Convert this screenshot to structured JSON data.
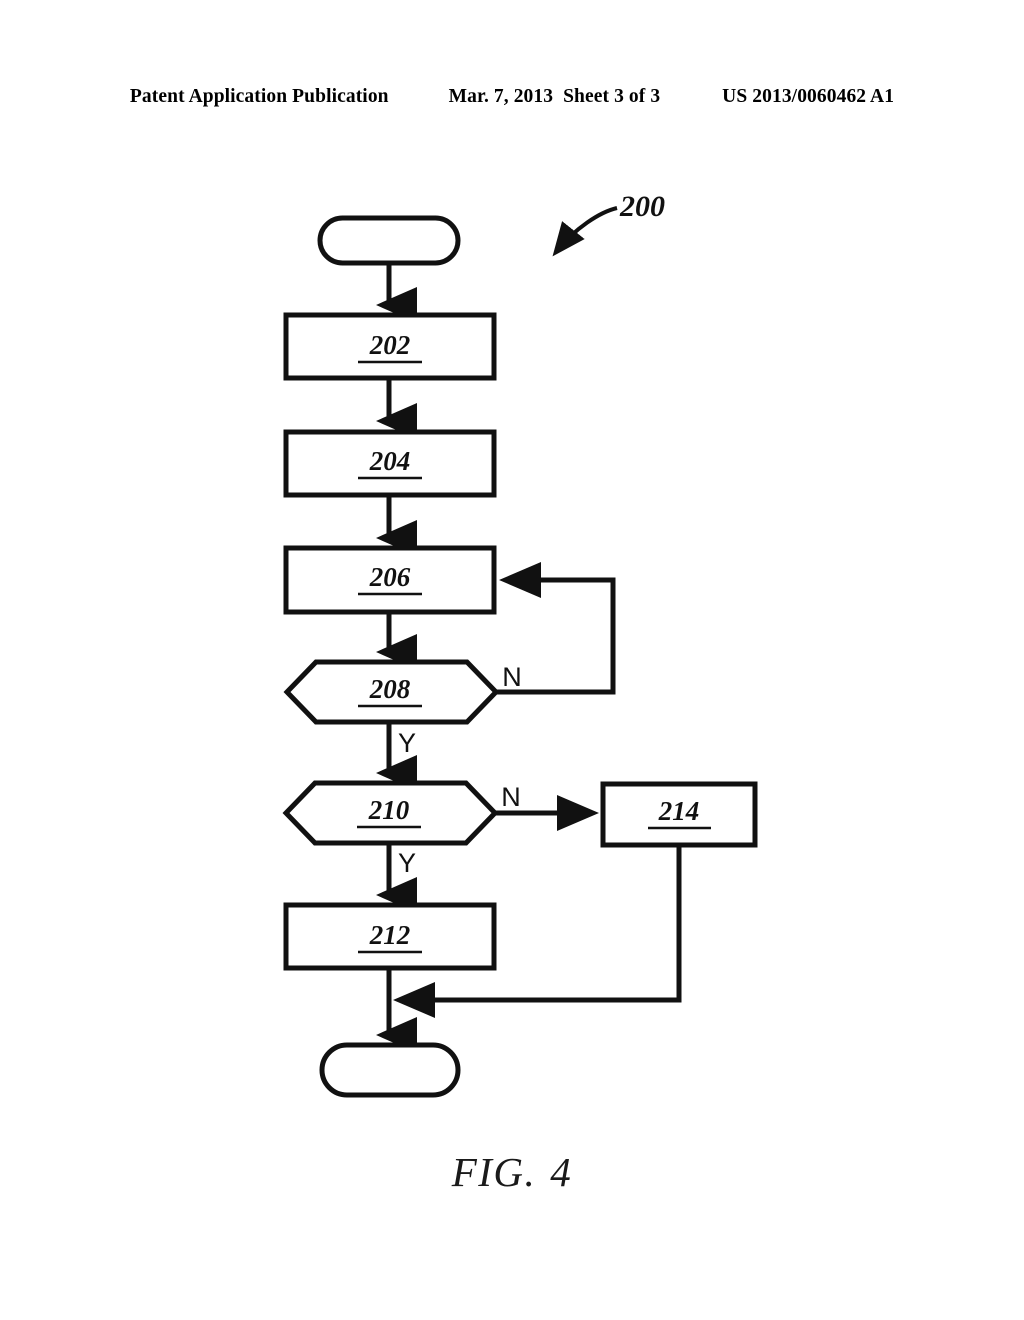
{
  "header": {
    "publication": "Patent Application Publication",
    "date": "Mar. 7, 2013",
    "sheet": "Sheet 3 of 3",
    "patent_number": "US 2013/0060462 A1"
  },
  "figure": {
    "caption_word": "FIG.",
    "caption_number": "4",
    "reference_numeral": "200"
  },
  "flowchart": {
    "type": "flowchart",
    "start_terminator": "",
    "end_terminator": "",
    "nodes": [
      {
        "id": "start",
        "shape": "terminator",
        "label": ""
      },
      {
        "id": "202",
        "shape": "process",
        "label": "202"
      },
      {
        "id": "204",
        "shape": "process",
        "label": "204"
      },
      {
        "id": "206",
        "shape": "process",
        "label": "206"
      },
      {
        "id": "208",
        "shape": "decision",
        "label": "208"
      },
      {
        "id": "210",
        "shape": "decision",
        "label": "210"
      },
      {
        "id": "212",
        "shape": "process",
        "label": "212"
      },
      {
        "id": "214",
        "shape": "process",
        "label": "214"
      },
      {
        "id": "end",
        "shape": "terminator",
        "label": ""
      }
    ],
    "edges": [
      {
        "from": "start",
        "to": "202",
        "label": ""
      },
      {
        "from": "202",
        "to": "204",
        "label": ""
      },
      {
        "from": "204",
        "to": "206",
        "label": ""
      },
      {
        "from": "206",
        "to": "208",
        "label": ""
      },
      {
        "from": "208",
        "to": "210",
        "label": "Y"
      },
      {
        "from": "208",
        "to": "206",
        "label": "N"
      },
      {
        "from": "210",
        "to": "212",
        "label": "Y"
      },
      {
        "from": "210",
        "to": "214",
        "label": "N"
      },
      {
        "from": "212",
        "to": "end",
        "label": ""
      },
      {
        "from": "214",
        "to": "end",
        "label": ""
      }
    ],
    "branch_labels": {
      "d208_no": "N",
      "d208_yes": "Y",
      "d210_no": "N",
      "d210_yes": "Y"
    }
  },
  "colors": {
    "ink": "#111111",
    "paper": "#ffffff"
  }
}
